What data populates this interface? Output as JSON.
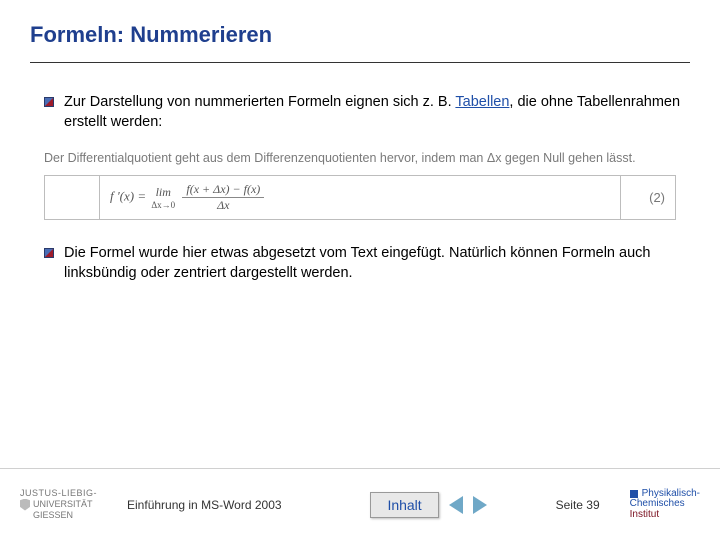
{
  "title": "Formeln: Nummerieren",
  "bullets": {
    "b1_pre": "Zur Darstellung von nummerierten Formeln eignen sich z. B. ",
    "b1_link": "Tabellen",
    "b1_post": ", die ohne Tabellenrahmen erstellt werden:",
    "b2": "Die Formel wurde hier etwas abgesetzt vom Text eingefügt. Natürlich können Formeln auch linksbündig oder zentriert dargestellt werden."
  },
  "example": {
    "intro": "Der Differentialquotient geht aus dem Differenzenquotienten hervor, indem man Δx gegen Null gehen lässt.",
    "formula_lhs": "f '(x) =",
    "formula_lim": "lim",
    "formula_limsub": "Δx→0",
    "formula_num": "f(x + Δx) − f(x)",
    "formula_den": "Δx",
    "eq_number": "(2)"
  },
  "footer": {
    "uni_l1": "JUSTUS-LIEBIG-",
    "uni_l2a": "UNIVERSITÄT",
    "uni_l2b": "GIESSEN",
    "course": "Einführung in MS-Word 2003",
    "inhalt": "Inhalt",
    "page": "Seite 39",
    "inst_l1": "Physikalisch-",
    "inst_l2": "Chemisches",
    "inst_l3": "Institut"
  }
}
